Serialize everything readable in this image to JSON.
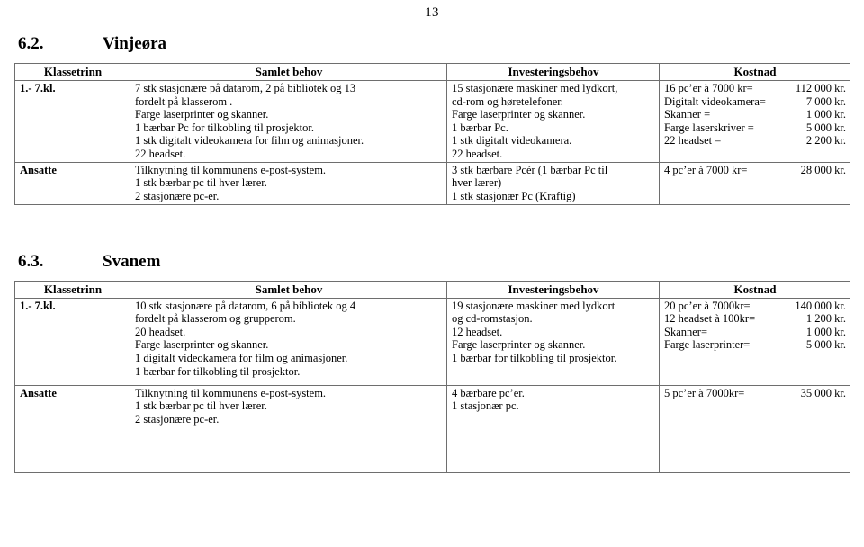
{
  "page": {
    "number": "13"
  },
  "sections": [
    {
      "number": "6.2.",
      "title": "Vinjeøra",
      "table": {
        "headers": {
          "klassetrinn": "Klassetrinn",
          "samlet_behov": "Samlet behov",
          "investeringsbehov": "Investeringsbehov",
          "kostnad": "Kostnad"
        },
        "rows": [
          {
            "klassetrinn": "1.- 7.kl.",
            "samlet_behov": [
              "7 stk stasjonære på datarom, 2 på bibliotek og 13",
              "fordelt på klasserom .",
              "Farge laserprinter og skanner.",
              "1 bærbar Pc for tilkobling til prosjektor.",
              "1 stk digitalt videokamera for film og animasjoner.",
              "22 headset."
            ],
            "investeringsbehov": [
              "15 stasjonære maskiner med lydkort,",
              "cd-rom og høretelefoner.",
              "Farge laserprinter og skanner.",
              "1 bærbar Pc.",
              "1 stk digitalt videokamera.",
              "22 headset."
            ],
            "kostnad": [
              {
                "label": "16 pc’er à 7000 kr=",
                "amount": "112 000 kr."
              },
              {
                "label": "Digitalt videokamera=",
                "amount": "7 000 kr."
              },
              {
                "label": "Skanner =",
                "amount": "1 000 kr."
              },
              {
                "label": "Farge laserskriver =",
                "amount": "5 000 kr."
              },
              {
                "label": "22 headset =",
                "amount": "2 200 kr."
              }
            ]
          },
          {
            "klassetrinn": "Ansatte",
            "samlet_behov": [
              "Tilknytning til kommunens e-post-system.",
              "1 stk bærbar pc til hver lærer.",
              "2 stasjonære pc-er."
            ],
            "investeringsbehov": [
              "3 stk bærbare Pcér (1 bærbar Pc til",
              "hver lærer)",
              "1 stk stasjonær Pc (Kraftig)"
            ],
            "kostnad": [
              {
                "label": "4 pc’er à 7000 kr=",
                "amount": "28 000 kr."
              }
            ]
          }
        ]
      }
    },
    {
      "number": "6.3.",
      "title": "Svanem",
      "table": {
        "headers": {
          "klassetrinn": "Klassetrinn",
          "samlet_behov": "Samlet behov",
          "investeringsbehov": "Investeringsbehov",
          "kostnad": "Kostnad"
        },
        "rows": [
          {
            "klassetrinn": "1.- 7.kl.",
            "samlet_behov": [
              "10 stk stasjonære på datarom, 6 på bibliotek og 4",
              "fordelt på klasserom og grupperom.",
              "20 headset.",
              "Farge laserprinter og skanner.",
              "1 digitalt videokamera for film og animasjoner.",
              "1 bærbar for tilkobling til prosjektor."
            ],
            "investeringsbehov": [
              "19 stasjonære maskiner med lydkort",
              "og cd-romstasjon.",
              "12 headset.",
              "Farge laserprinter og skanner.",
              "1 bærbar for tilkobling til prosjektor."
            ],
            "kostnad": [
              {
                "label": "20 pc’er à 7000kr=",
                "amount": "140 000 kr."
              },
              {
                "label": "12 headset à 100kr=",
                "amount": "1 200 kr."
              },
              {
                "label": "Skanner=",
                "amount": "1 000 kr."
              },
              {
                "label": "Farge laserprinter=",
                "amount": "5 000 kr."
              }
            ]
          },
          {
            "klassetrinn": "Ansatte",
            "samlet_behov": [
              "Tilknytning til kommunens e-post-system.",
              "1 stk bærbar pc til hver lærer.",
              "2 stasjonære pc-er."
            ],
            "investeringsbehov": [
              "4 bærbare pc’er.",
              "1 stasjonær pc."
            ],
            "kostnad": [
              {
                "label": "5 pc’er à 7000kr=",
                "amount": "35 000 kr."
              }
            ]
          }
        ]
      }
    }
  ]
}
